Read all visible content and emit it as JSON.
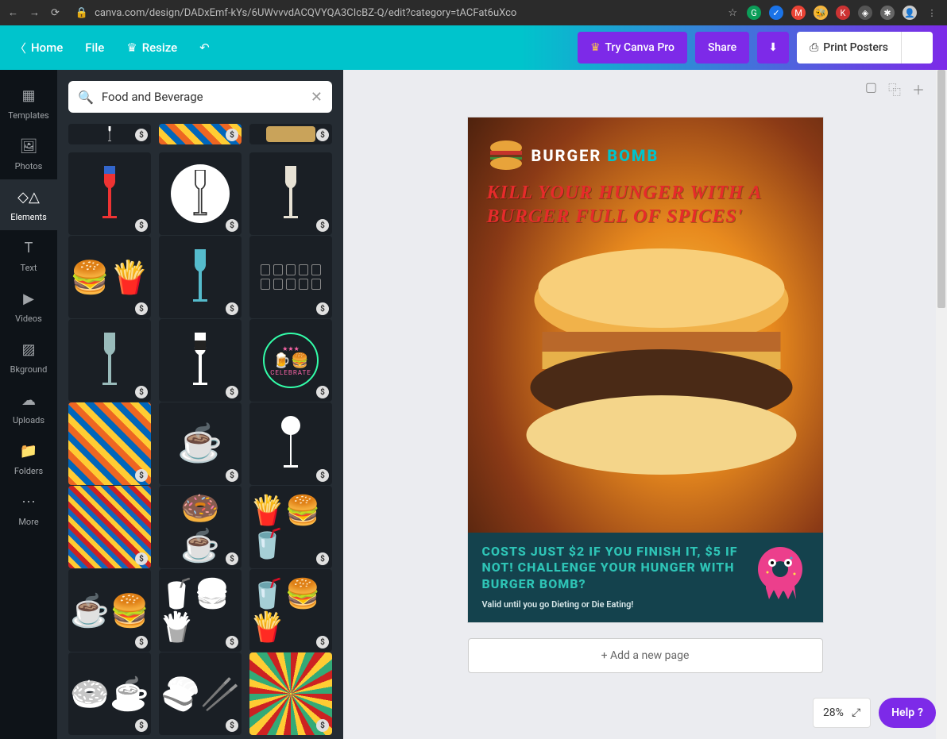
{
  "browser": {
    "url": "canva.com/design/DADxEmf-kYs/6UWvvvdACQVYQA3CIcBZ-Q/edit?category=tACFat6uXco"
  },
  "toolbar": {
    "home": "Home",
    "file": "File",
    "resize": "Resize",
    "try_pro": "Try Canva Pro",
    "share": "Share",
    "print": "Print Posters"
  },
  "rail": {
    "templates": "Templates",
    "photos": "Photos",
    "elements": "Elements",
    "text": "Text",
    "videos": "Videos",
    "bkground": "Bkground",
    "uploads": "Uploads",
    "folders": "Folders",
    "more": "More"
  },
  "search": {
    "value": "Food and Beverage"
  },
  "poster": {
    "brand_a": "BURGER ",
    "brand_b": "BOMB",
    "tagline": "KILL YOUR HUNGER WITH A BURGER FULL OF SPICES'",
    "footer_big": "COSTS JUST $2 IF YOU FINISH IT, $5 IF NOT! CHALLENGE YOUR HUNGER WITH BURGER BOMB?",
    "footer_small": "Valid until you go Dieting or Die Eating!"
  },
  "canvas": {
    "add_page": "+ Add a new page",
    "zoom": "28%",
    "help": "Help"
  },
  "elements": {
    "badge": "$"
  }
}
